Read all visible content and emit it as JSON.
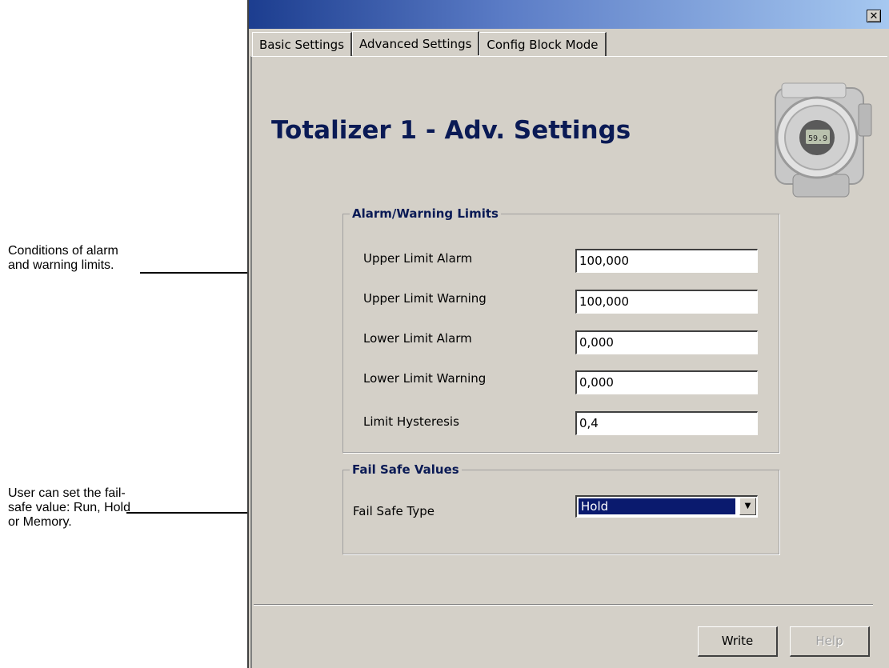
{
  "annotations": {
    "limits_note": "Conditions of alarm and warning limits.",
    "failsafe_note": "User can set the fail-safe value: Run, Hold or Memory."
  },
  "window": {
    "close_glyph": "✕"
  },
  "tabs": [
    {
      "label": "Basic Settings",
      "active": false
    },
    {
      "label": "Advanced Settings",
      "active": true
    },
    {
      "label": "Config Block Mode",
      "active": false
    }
  ],
  "page_title": "Totalizer 1 - Adv. Settings",
  "device_display": "59.9",
  "alarm_group": {
    "legend": "Alarm/Warning Limits",
    "rows": [
      {
        "label": "Upper Limit Alarm",
        "value": "100,000"
      },
      {
        "label": "Upper Limit Warning",
        "value": "100,000"
      },
      {
        "label": "Lower Limit Alarm",
        "value": "0,000"
      },
      {
        "label": "Lower Limit Warning",
        "value": "0,000"
      },
      {
        "label": "Limit Hysteresis",
        "value": "0,4"
      }
    ]
  },
  "failsafe_group": {
    "legend": "Fail Safe Values",
    "label": "Fail Safe Type",
    "selected": "Hold"
  },
  "buttons": {
    "write": "Write",
    "help": "Help"
  },
  "colors": {
    "title_blue": "#0a1a55",
    "selection": "#0a1a6e",
    "window_face": "#d4d0c8"
  }
}
